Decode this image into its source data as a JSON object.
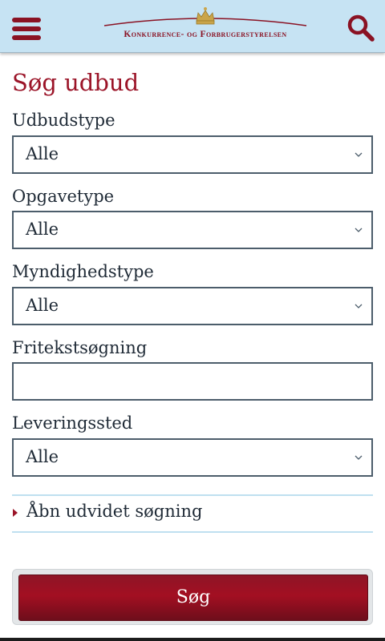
{
  "header": {
    "menu_icon": "hamburger-menu-icon",
    "logo_text": "Konkurrence- og Forbrugerstyrelsen",
    "search_icon": "search-icon",
    "background": "#c6e3f3",
    "accent": "#8a1223"
  },
  "page": {
    "title": "Søg udbud",
    "title_color": "#9b1428"
  },
  "form": {
    "udbudstype": {
      "label": "Udbudstype",
      "value": "Alle"
    },
    "opgavetype": {
      "label": "Opgavetype",
      "value": "Alle"
    },
    "myndighedstype": {
      "label": "Myndighedstype",
      "value": "Alle"
    },
    "fritekst": {
      "label": "Fritekstsøgning",
      "value": ""
    },
    "leveringssted": {
      "label": "Leveringssted",
      "value": "Alle"
    },
    "chevron_icon": "chevron-down-icon"
  },
  "advanced": {
    "label": "Åbn udvidet søgning",
    "arrow_icon": "triangle-right-icon"
  },
  "submit": {
    "label": "Søg",
    "color": "#a30f22"
  }
}
